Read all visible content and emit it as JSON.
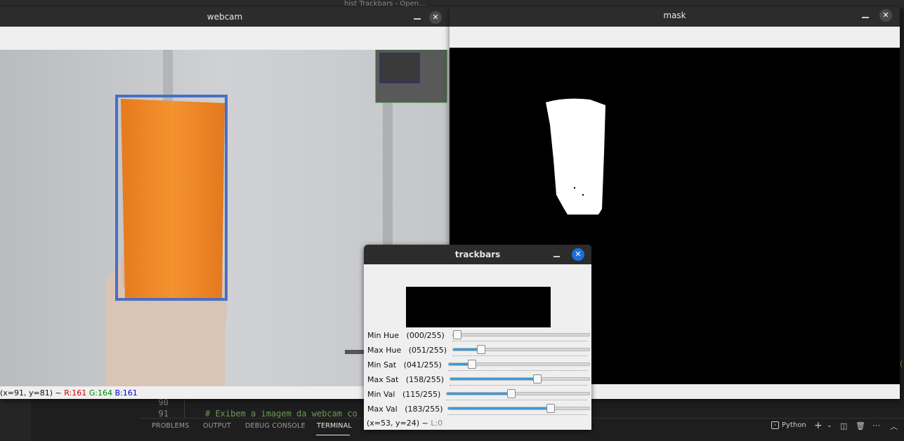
{
  "ide": {
    "top_text": "hist Trackbars - Open...",
    "line_numbers": [
      "90",
      "91"
    ],
    "code_line": "# Exibem a imagem da webcam co",
    "panel_tabs": [
      "PROBLEMS",
      "OUTPUT",
      "DEBUG CONSOLE",
      "TERMINAL"
    ],
    "active_tab": "TERMINAL",
    "terminal_name": "Python",
    "edge_char": "("
  },
  "webcam": {
    "title": "webcam",
    "status": {
      "coords": "(x=91, y=81) ~",
      "r": "R:161",
      "g": "G:164",
      "b": "B:161"
    }
  },
  "mask": {
    "title": "mask"
  },
  "trackbars": {
    "title": "trackbars",
    "rows": [
      {
        "label": "Min Hue",
        "value": "(000/255)",
        "fraction": 0.0
      },
      {
        "label": "Max Hue",
        "value": "(051/255)",
        "fraction": 0.2
      },
      {
        "label": "Min Sat",
        "value": "(041/255)",
        "fraction": 0.16
      },
      {
        "label": "Max Sat",
        "value": "(158/255)",
        "fraction": 0.62
      },
      {
        "label": "Min Val",
        "value": "(115/255)",
        "fraction": 0.45
      },
      {
        "label": "Max Val",
        "value": "(183/255)",
        "fraction": 0.72
      }
    ],
    "status": {
      "coords": "(x=53, y=24) ~",
      "level": "L:0"
    }
  },
  "colors": {
    "bounding_box": "#4a6fc0",
    "object": "#f08a2a",
    "accent": "#3d9ad6",
    "close_active": "#1e6fd9"
  },
  "icons": [
    "minimize-icon",
    "close-icon",
    "terminal-icon",
    "plus-icon",
    "chevron-down-icon",
    "split-icon",
    "trash-icon",
    "more-icon",
    "chevron-up-icon"
  ]
}
